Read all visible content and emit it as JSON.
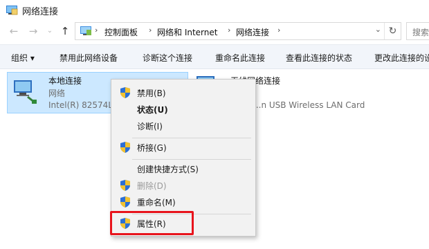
{
  "window": {
    "title": "网络连接",
    "icon": "network-folder-icon"
  },
  "nav": {
    "back_icon": "back-arrow-icon",
    "forward_icon": "forward-arrow-icon",
    "recent_icon": "chevron-down-icon",
    "up_icon": "up-arrow-icon"
  },
  "address": {
    "crumbs": [
      "控制面板",
      "网络和 Internet",
      "网络连接"
    ],
    "separator": "›",
    "search_placeholder": "搜索"
  },
  "toolbar": {
    "organize": "组织 ▾",
    "items": [
      "禁用此网络设备",
      "诊断这个连接",
      "重命名此连接",
      "查看此连接的状态",
      "更改此连接的设置"
    ]
  },
  "connections": [
    {
      "name": "本地连接",
      "status": "网络",
      "device": "Intel(R) 82574L",
      "selected": true
    },
    {
      "name": "无线网络连接",
      "status": "",
      "device": "...n USB Wireless LAN Card",
      "selected": false
    }
  ],
  "context_menu": {
    "items": [
      {
        "label": "禁用(B)",
        "shield": true
      },
      {
        "label": "状态(U)",
        "bold": true
      },
      {
        "label": "诊断(I)"
      },
      {
        "label": "桥接(G)",
        "shield": true
      },
      {
        "label": "创建快捷方式(S)"
      },
      {
        "label": "删除(D)",
        "shield": true,
        "disabled": true
      },
      {
        "label": "重命名(M)",
        "shield": true
      },
      {
        "label": "属性(R)",
        "shield": true,
        "highlighted": true
      }
    ]
  },
  "colors": {
    "selection": "#cce8ff",
    "highlight_box": "#e8141c",
    "toolbar_bg": "#f2f5fa"
  }
}
